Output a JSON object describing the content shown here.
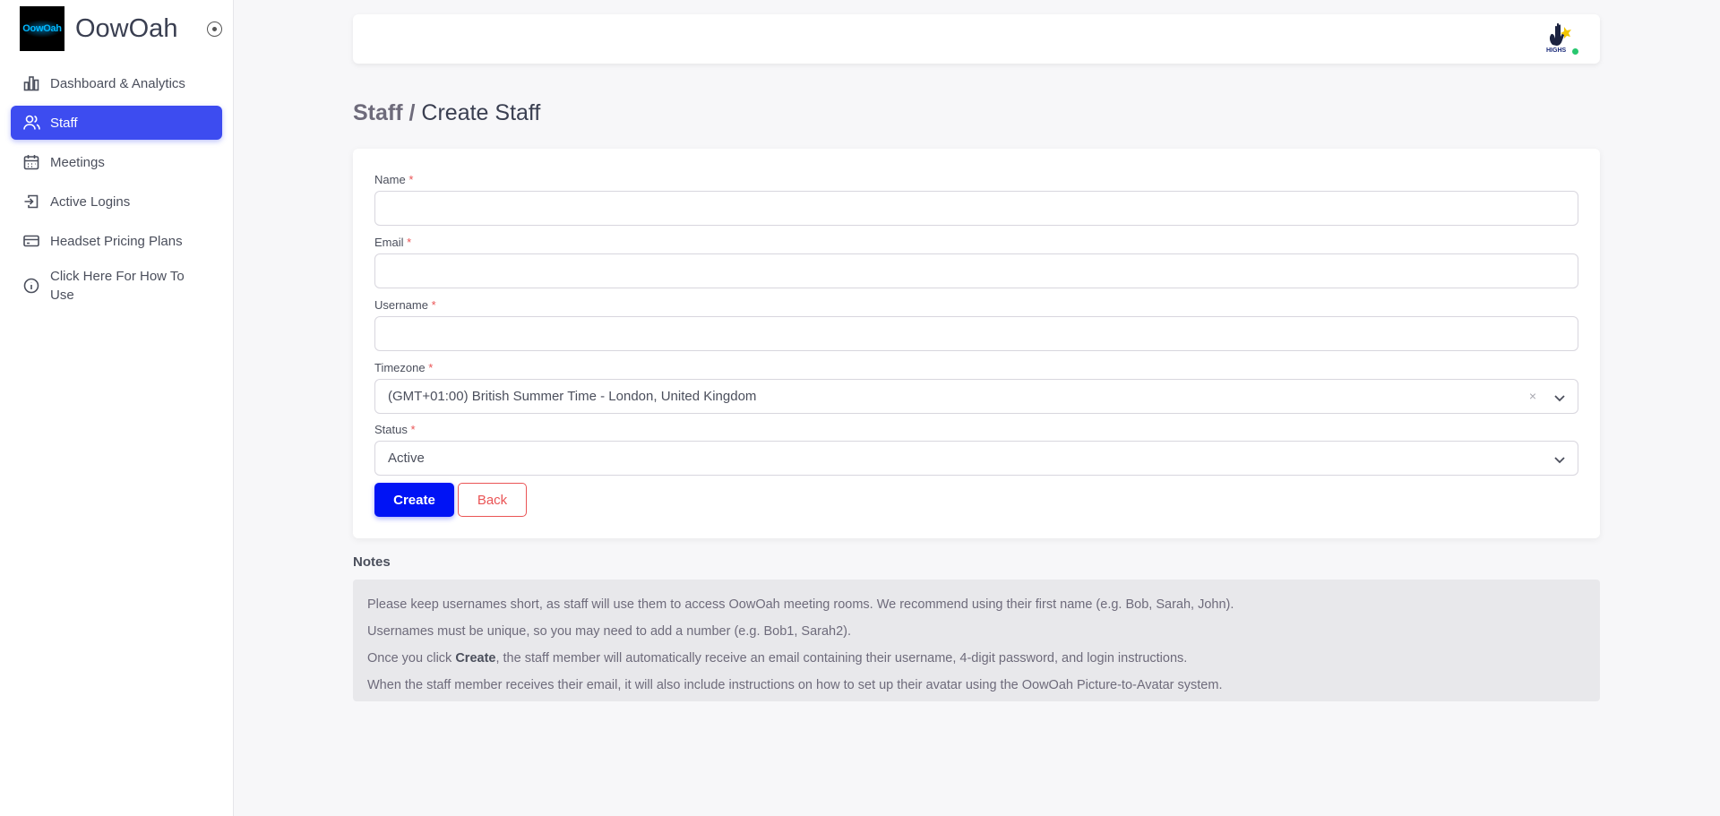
{
  "brand": {
    "logo_text": "OowOah",
    "name": "OowOah"
  },
  "nav": {
    "items": [
      {
        "label": "Dashboard & Analytics",
        "icon": "bar-chart-icon",
        "active": false
      },
      {
        "label": "Staff",
        "icon": "users-icon",
        "active": true
      },
      {
        "label": "Meetings",
        "icon": "calendar-icon",
        "active": false
      },
      {
        "label": "Active Logins",
        "icon": "log-in-icon",
        "active": false
      },
      {
        "label": "Headset Pricing Plans",
        "icon": "credit-card-icon",
        "active": false
      },
      {
        "label": "Click Here For How To Use",
        "icon": "info-icon",
        "active": false
      }
    ]
  },
  "header": {
    "avatar_text": "HIGHS",
    "status_color": "#28c76f"
  },
  "page": {
    "breadcrumb_parent": "Staff",
    "separator": "/",
    "title": "Create Staff"
  },
  "form": {
    "name_label": "Name",
    "email_label": "Email",
    "username_label": "Username",
    "timezone_label": "Timezone",
    "timezone_value": "(GMT+01:00) British Summer Time - London, United Kingdom",
    "status_label": "Status",
    "status_value": "Active",
    "required_mark": "*",
    "create_label": "Create",
    "back_label": "Back"
  },
  "notes": {
    "title": "Notes",
    "line1": "Please keep usernames short, as staff will use them to access OowOah meeting rooms. We recommend using their first name (e.g. Bob, Sarah, John).",
    "line2": "Usernames must be unique, so you may need to add a number (e.g. Bob1, Sarah2).",
    "line3_pre": "Once you click ",
    "line3_bold": "Create",
    "line3_post": ", the staff member will automatically receive an email containing their username, 4-digit password, and login instructions.",
    "line4": "When the staff member receives their email, it will also include instructions on how to set up their avatar using the OowOah Picture-to-Avatar system."
  },
  "colors": {
    "accent": "#3d4cf0",
    "primary_button": "#0013f5",
    "danger": "#ea5455"
  }
}
